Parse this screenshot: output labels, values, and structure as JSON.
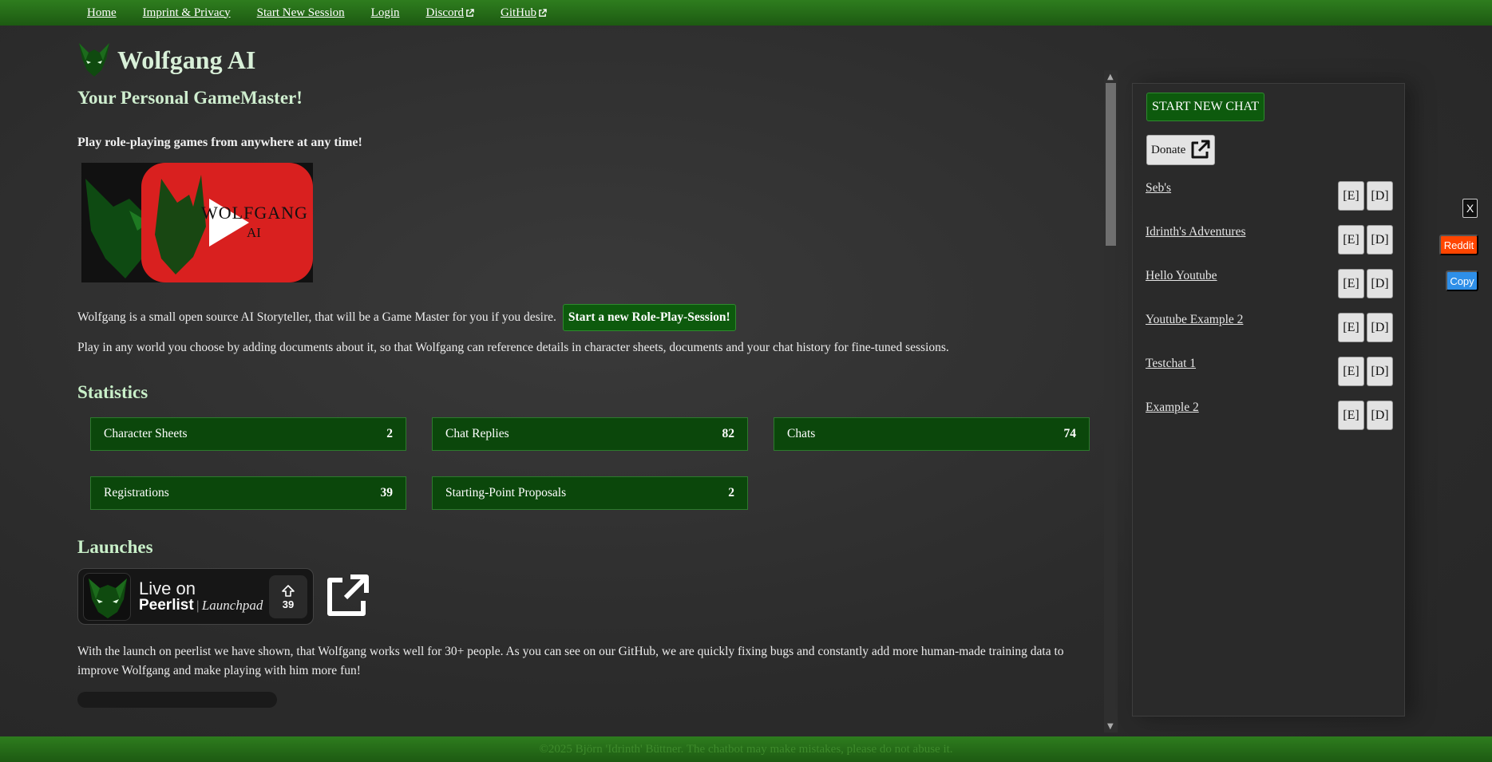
{
  "nav": {
    "home": "Home",
    "imprint": "Imprint & Privacy",
    "start_session": "Start New Session",
    "login": "Login",
    "discord": "Discord",
    "github": "GitHub"
  },
  "header": {
    "title": "Wolfgang AI",
    "tagline": "Your Personal GameMaster!",
    "lead": "Play role-playing games from anywhere at any time!"
  },
  "video": {
    "logo_line1": "WOLFGANG",
    "logo_line2": "AI"
  },
  "intro": {
    "text1": "Wolfgang is a small open source AI Storyteller, that will be a Game Master for you if you desire.",
    "cta_button": "Start a new Role-Play-Session!",
    "text2": "Play in any world you choose by adding documents about it, so that Wolfgang can reference details in character sheets, documents and your chat history for fine-tuned sessions."
  },
  "statistics": {
    "title": "Statistics",
    "items": [
      {
        "label": "Character Sheets",
        "value": "2"
      },
      {
        "label": "Chat Replies",
        "value": "82"
      },
      {
        "label": "Chats",
        "value": "74"
      },
      {
        "label": "Registrations",
        "value": "39"
      },
      {
        "label": "Starting-Point Proposals",
        "value": "2"
      }
    ]
  },
  "launches": {
    "title": "Launches",
    "peerlist_live": "Live on",
    "peerlist_brand": "Peerlist",
    "peerlist_sep": "|",
    "peerlist_launchpad": "Launchpad",
    "peerlist_votes": "39",
    "text": "With the launch on peerlist we have shown, that Wolfgang works well for 30+ people. As you can see on our GitHub, we are quickly fixing bugs and constantly add more human-made training data to improve Wolfgang and make playing with him more fun!"
  },
  "sidebar": {
    "start_chat": "START NEW CHAT",
    "donate": "Donate",
    "edit_label": "[E]",
    "delete_label": "[D]",
    "chats": [
      {
        "name": "Seb's"
      },
      {
        "name": "Idrinth's Adventures"
      },
      {
        "name": "Hello Youtube"
      },
      {
        "name": "Youtube Example 2"
      },
      {
        "name": "Testchat 1"
      },
      {
        "name": "Example 2"
      }
    ]
  },
  "floating": {
    "close": "X",
    "reddit": "Reddit",
    "copy": "Copy"
  },
  "footer": {
    "text": "©2025 Björn 'Idrinth' Büttner. The chatbot may make mistakes, please do not abuse it."
  },
  "colors": {
    "nav_green": "#2e7d1e",
    "panel_green": "#0b470b",
    "heading_green": "#c9f0c9",
    "reddit": "#ff4500",
    "copy": "#2e8fe8"
  },
  "icons": {
    "logo": "wolf-head-icon",
    "external": "external-link-icon",
    "vote": "arrow-up-icon",
    "play": "play-icon"
  }
}
